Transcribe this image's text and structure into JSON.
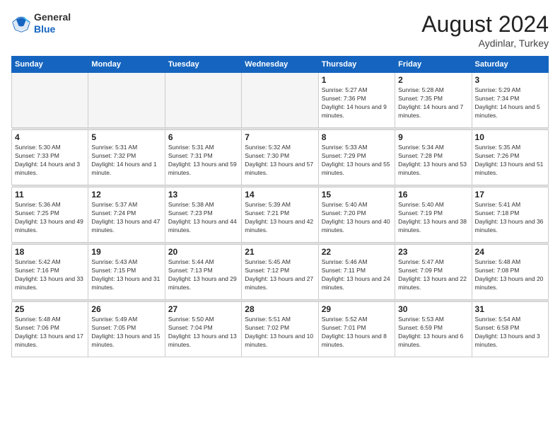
{
  "header": {
    "logo": {
      "general": "General",
      "blue": "Blue"
    },
    "title": "August 2024",
    "location": "Aydinlar, Turkey"
  },
  "calendar": {
    "days_of_week": [
      "Sunday",
      "Monday",
      "Tuesday",
      "Wednesday",
      "Thursday",
      "Friday",
      "Saturday"
    ],
    "weeks": [
      [
        {
          "day": "",
          "info": ""
        },
        {
          "day": "",
          "info": ""
        },
        {
          "day": "",
          "info": ""
        },
        {
          "day": "",
          "info": ""
        },
        {
          "day": "1",
          "info": "Sunrise: 5:27 AM\nSunset: 7:36 PM\nDaylight: 14 hours and 9 minutes."
        },
        {
          "day": "2",
          "info": "Sunrise: 5:28 AM\nSunset: 7:35 PM\nDaylight: 14 hours and 7 minutes."
        },
        {
          "day": "3",
          "info": "Sunrise: 5:29 AM\nSunset: 7:34 PM\nDaylight: 14 hours and 5 minutes."
        }
      ],
      [
        {
          "day": "4",
          "info": "Sunrise: 5:30 AM\nSunset: 7:33 PM\nDaylight: 14 hours and 3 minutes."
        },
        {
          "day": "5",
          "info": "Sunrise: 5:31 AM\nSunset: 7:32 PM\nDaylight: 14 hours and 1 minute."
        },
        {
          "day": "6",
          "info": "Sunrise: 5:31 AM\nSunset: 7:31 PM\nDaylight: 13 hours and 59 minutes."
        },
        {
          "day": "7",
          "info": "Sunrise: 5:32 AM\nSunset: 7:30 PM\nDaylight: 13 hours and 57 minutes."
        },
        {
          "day": "8",
          "info": "Sunrise: 5:33 AM\nSunset: 7:29 PM\nDaylight: 13 hours and 55 minutes."
        },
        {
          "day": "9",
          "info": "Sunrise: 5:34 AM\nSunset: 7:28 PM\nDaylight: 13 hours and 53 minutes."
        },
        {
          "day": "10",
          "info": "Sunrise: 5:35 AM\nSunset: 7:26 PM\nDaylight: 13 hours and 51 minutes."
        }
      ],
      [
        {
          "day": "11",
          "info": "Sunrise: 5:36 AM\nSunset: 7:25 PM\nDaylight: 13 hours and 49 minutes."
        },
        {
          "day": "12",
          "info": "Sunrise: 5:37 AM\nSunset: 7:24 PM\nDaylight: 13 hours and 47 minutes."
        },
        {
          "day": "13",
          "info": "Sunrise: 5:38 AM\nSunset: 7:23 PM\nDaylight: 13 hours and 44 minutes."
        },
        {
          "day": "14",
          "info": "Sunrise: 5:39 AM\nSunset: 7:21 PM\nDaylight: 13 hours and 42 minutes."
        },
        {
          "day": "15",
          "info": "Sunrise: 5:40 AM\nSunset: 7:20 PM\nDaylight: 13 hours and 40 minutes."
        },
        {
          "day": "16",
          "info": "Sunrise: 5:40 AM\nSunset: 7:19 PM\nDaylight: 13 hours and 38 minutes."
        },
        {
          "day": "17",
          "info": "Sunrise: 5:41 AM\nSunset: 7:18 PM\nDaylight: 13 hours and 36 minutes."
        }
      ],
      [
        {
          "day": "18",
          "info": "Sunrise: 5:42 AM\nSunset: 7:16 PM\nDaylight: 13 hours and 33 minutes."
        },
        {
          "day": "19",
          "info": "Sunrise: 5:43 AM\nSunset: 7:15 PM\nDaylight: 13 hours and 31 minutes."
        },
        {
          "day": "20",
          "info": "Sunrise: 5:44 AM\nSunset: 7:13 PM\nDaylight: 13 hours and 29 minutes."
        },
        {
          "day": "21",
          "info": "Sunrise: 5:45 AM\nSunset: 7:12 PM\nDaylight: 13 hours and 27 minutes."
        },
        {
          "day": "22",
          "info": "Sunrise: 5:46 AM\nSunset: 7:11 PM\nDaylight: 13 hours and 24 minutes."
        },
        {
          "day": "23",
          "info": "Sunrise: 5:47 AM\nSunset: 7:09 PM\nDaylight: 13 hours and 22 minutes."
        },
        {
          "day": "24",
          "info": "Sunrise: 5:48 AM\nSunset: 7:08 PM\nDaylight: 13 hours and 20 minutes."
        }
      ],
      [
        {
          "day": "25",
          "info": "Sunrise: 5:48 AM\nSunset: 7:06 PM\nDaylight: 13 hours and 17 minutes."
        },
        {
          "day": "26",
          "info": "Sunrise: 5:49 AM\nSunset: 7:05 PM\nDaylight: 13 hours and 15 minutes."
        },
        {
          "day": "27",
          "info": "Sunrise: 5:50 AM\nSunset: 7:04 PM\nDaylight: 13 hours and 13 minutes."
        },
        {
          "day": "28",
          "info": "Sunrise: 5:51 AM\nSunset: 7:02 PM\nDaylight: 13 hours and 10 minutes."
        },
        {
          "day": "29",
          "info": "Sunrise: 5:52 AM\nSunset: 7:01 PM\nDaylight: 13 hours and 8 minutes."
        },
        {
          "day": "30",
          "info": "Sunrise: 5:53 AM\nSunset: 6:59 PM\nDaylight: 13 hours and 6 minutes."
        },
        {
          "day": "31",
          "info": "Sunrise: 5:54 AM\nSunset: 6:58 PM\nDaylight: 13 hours and 3 minutes."
        }
      ]
    ]
  }
}
